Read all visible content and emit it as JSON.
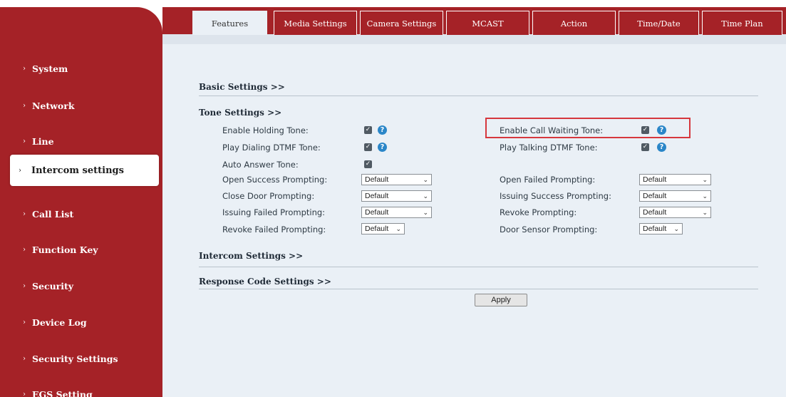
{
  "tabs": [
    {
      "label": "Features",
      "active": true
    },
    {
      "label": "Media Settings"
    },
    {
      "label": "Camera Settings"
    },
    {
      "label": "MCAST"
    },
    {
      "label": "Action"
    },
    {
      "label": "Time/Date"
    },
    {
      "label": "Time Plan"
    }
  ],
  "sidebar": {
    "items": [
      {
        "label": "System"
      },
      {
        "label": "Network"
      },
      {
        "label": "Line"
      },
      {
        "label": "Intercom settings",
        "active": true
      },
      {
        "label": "Call List"
      },
      {
        "label": "Function Key"
      },
      {
        "label": "Security"
      },
      {
        "label": "Device Log"
      },
      {
        "label": "Security Settings"
      },
      {
        "label": "EGS Setting"
      }
    ]
  },
  "sections": {
    "basic": "Basic Settings >>",
    "tone": "Tone Settings >>",
    "intercom": "Intercom Settings >>",
    "response": "Response Code Settings >>"
  },
  "tone": {
    "enable_holding_tone": {
      "label": "Enable Holding Tone:",
      "checked": true
    },
    "enable_call_waiting_tone": {
      "label": "Enable Call Waiting Tone:",
      "checked": true
    },
    "play_dialing_dtmf_tone": {
      "label": "Play Dialing DTMF Tone:",
      "checked": true
    },
    "play_talking_dtmf_tone": {
      "label": "Play Talking DTMF Tone:",
      "checked": true
    },
    "auto_answer_tone": {
      "label": "Auto Answer Tone:",
      "checked": true
    },
    "open_success_prompting": {
      "label": "Open Success Prompting:",
      "value": "Default"
    },
    "open_failed_prompting": {
      "label": "Open Failed Prompting:",
      "value": "Default"
    },
    "close_door_prompting": {
      "label": "Close Door Prompting:",
      "value": "Default"
    },
    "issuing_success_prompting": {
      "label": "Issuing Success Prompting:",
      "value": "Default"
    },
    "issuing_failed_prompting": {
      "label": "Issuing Failed Prompting:",
      "value": "Default"
    },
    "revoke_prompting": {
      "label": "Revoke Prompting:",
      "value": "Default"
    },
    "revoke_failed_prompting": {
      "label": "Revoke Failed Prompting:",
      "value": "Default"
    },
    "door_sensor_prompting": {
      "label": "Door Sensor Prompting:",
      "value": "Default"
    }
  },
  "apply_label": "Apply",
  "icons": {
    "checkbox": "checkbox-checked-icon",
    "help": "help-icon",
    "dropdown": "chevron-down-icon",
    "nav": "chevron-right-icon"
  },
  "colors": {
    "brand": "#a52227",
    "content_bg": "#eaf0f6",
    "highlight": "#d6373d",
    "help": "#2a86c8"
  }
}
